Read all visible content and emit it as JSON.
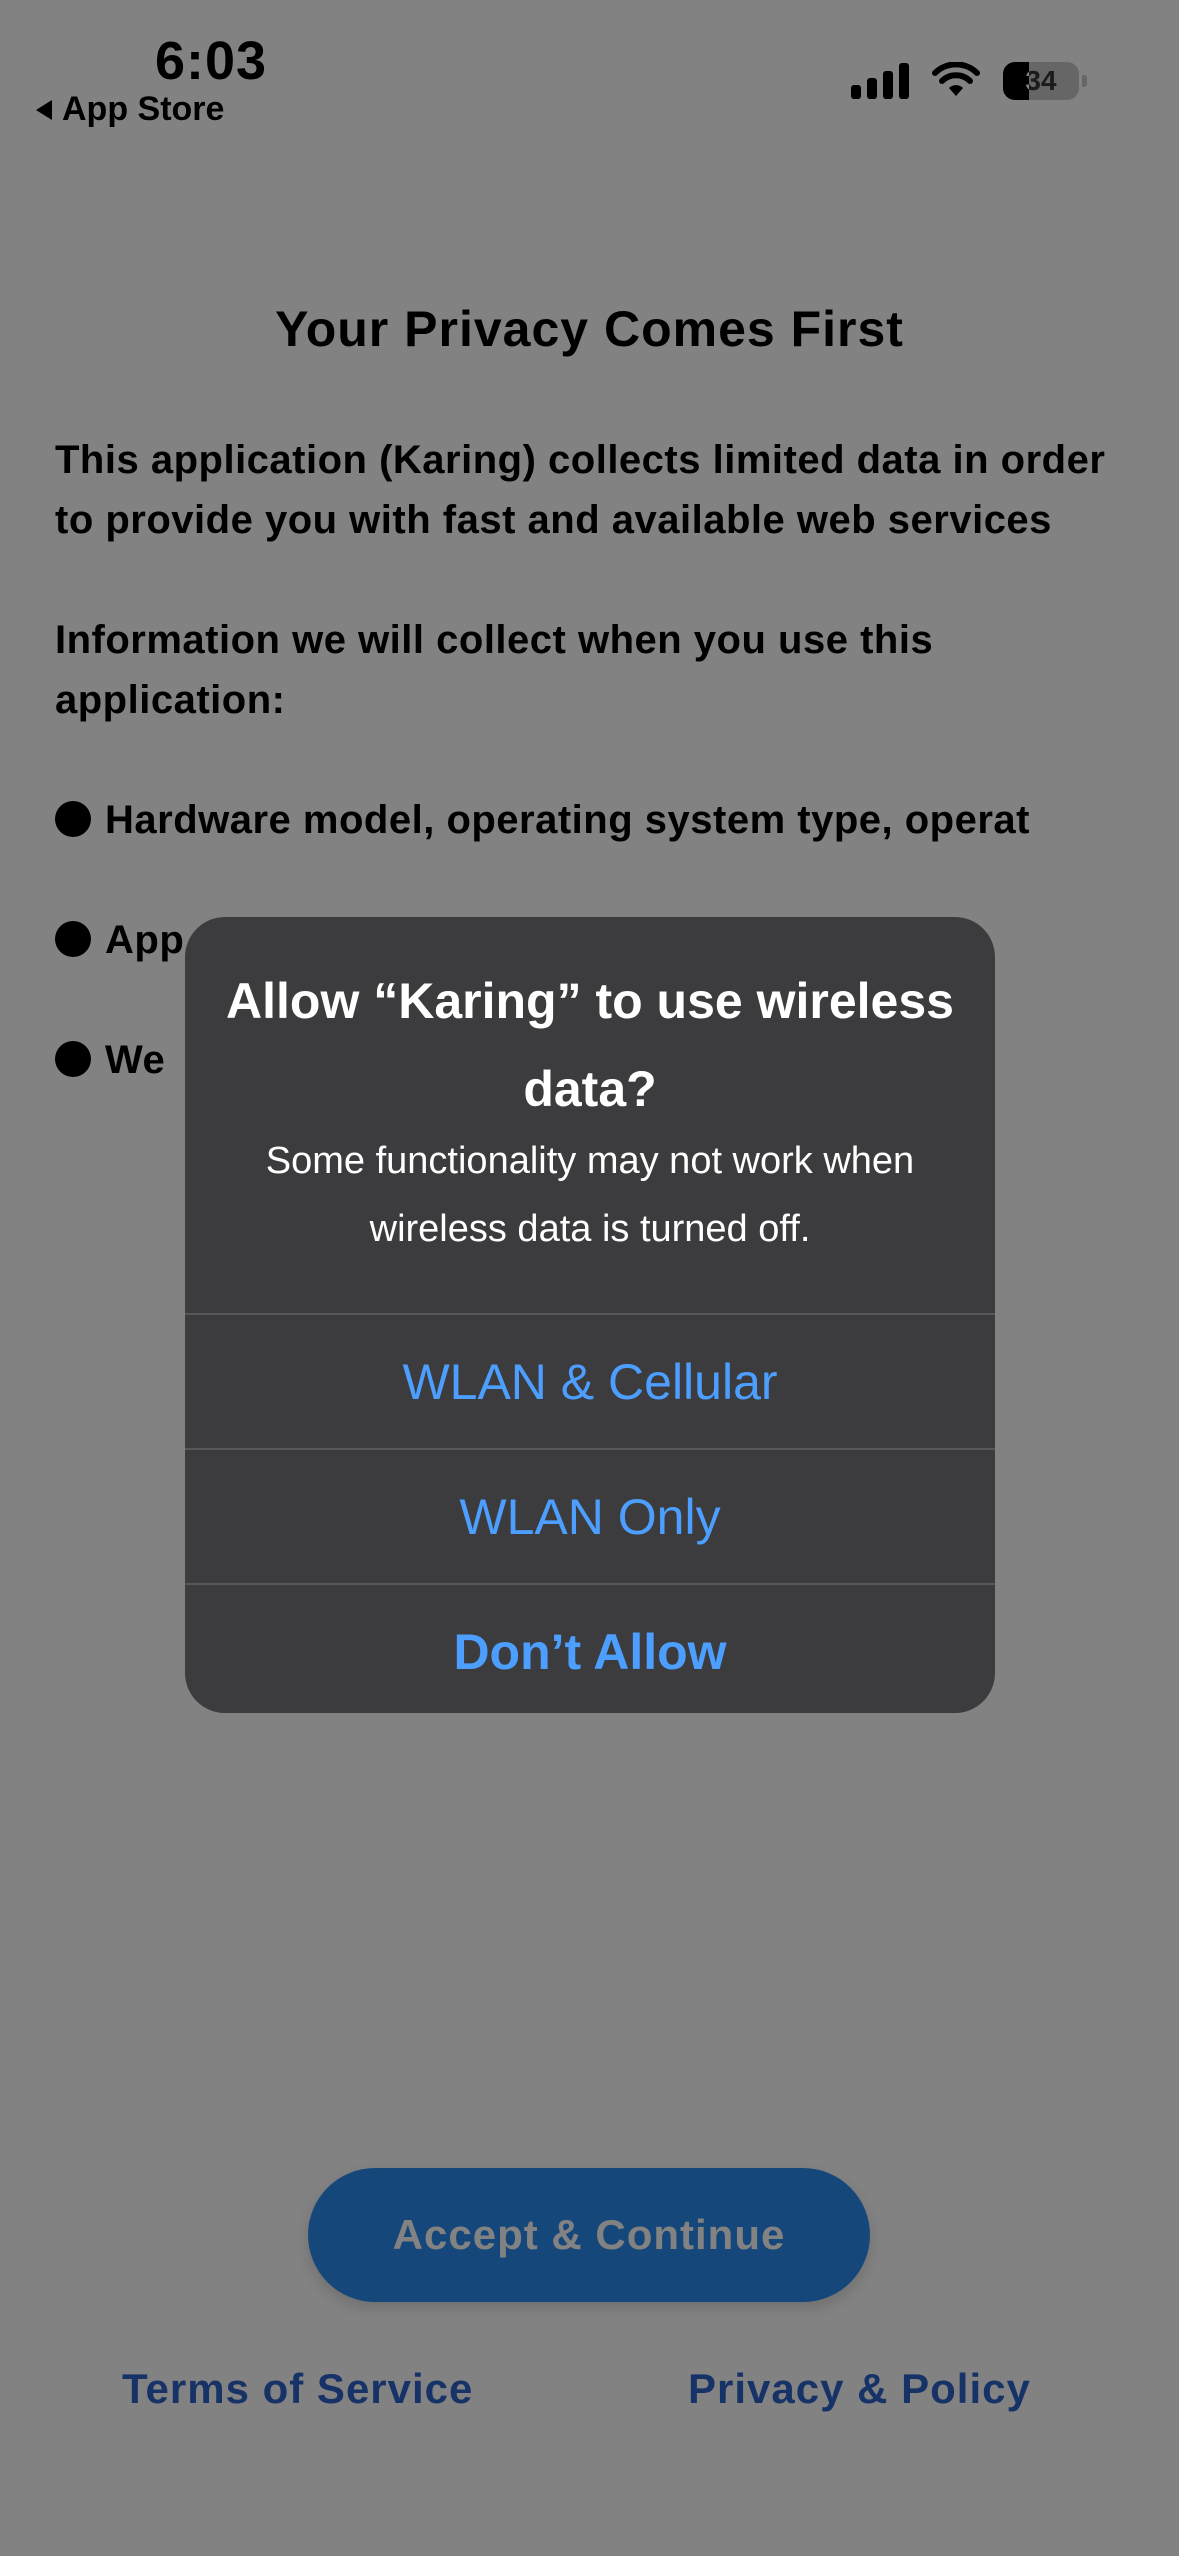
{
  "status_bar": {
    "time": "6:03",
    "back_label": "App Store",
    "battery": "34",
    "battery_level": 0.34
  },
  "page": {
    "title": "Your Privacy Comes First",
    "intro": "This application (Karing) collects limited data in order to provide you with fast and available web services",
    "collect_heading": "Information we will collect when you use this application:",
    "bullets": [
      "Hardware model, operating system type, operat",
      "App",
      "We"
    ],
    "accept_button": "Accept & Continue",
    "terms_link": "Terms of Service",
    "privacy_link": "Privacy & Policy"
  },
  "alert": {
    "title": "Allow “Karing” to use wireless data?",
    "message": "Some functionality may not work when wireless data is turned off.",
    "options": [
      "WLAN & Cellular",
      "WLAN Only",
      "Don’t Allow"
    ]
  },
  "colors": {
    "accent_button": "#2a8cf2",
    "link": "#2e63c8",
    "alert_background": "#3c3c3e",
    "alert_button_text": "#4c9eff"
  }
}
